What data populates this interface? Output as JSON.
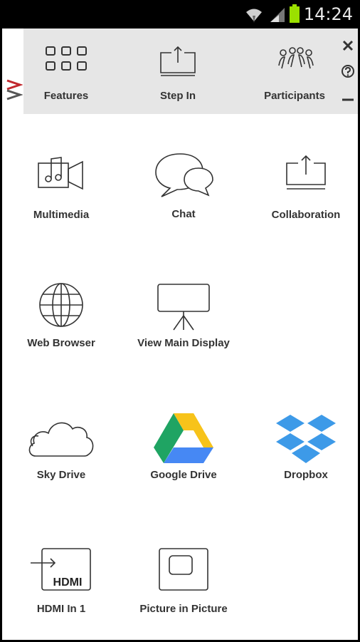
{
  "status_bar": {
    "time": "14:24",
    "icons": [
      "wifi-icon",
      "cell-signal-icon",
      "battery-icon"
    ]
  },
  "topbar": {
    "items": [
      {
        "label": "Features",
        "icon": "features-grid-icon"
      },
      {
        "label": "Step In",
        "icon": "step-in-icon"
      },
      {
        "label": "Participants",
        "icon": "participants-icon"
      }
    ],
    "controls": [
      "close-icon",
      "help-icon",
      "minimize-icon"
    ]
  },
  "grid": {
    "items": [
      {
        "label": "Multimedia",
        "icon": "multimedia-icon"
      },
      {
        "label": "Chat",
        "icon": "chat-icon"
      },
      {
        "label": "Collaboration",
        "icon": "collaboration-icon"
      },
      {
        "label": "Web Browser",
        "icon": "globe-icon"
      },
      {
        "label": "View Main Display",
        "icon": "projector-screen-icon"
      },
      {
        "label": "Sky Drive",
        "icon": "cloud-icon"
      },
      {
        "label": "Google Drive",
        "icon": "google-drive-icon"
      },
      {
        "label": "Dropbox",
        "icon": "dropbox-icon"
      },
      {
        "label": "HDMI In 1",
        "icon": "hdmi-input-icon"
      },
      {
        "label": "Picture in Picture",
        "icon": "picture-in-picture-icon"
      }
    ]
  },
  "colors": {
    "topbar_bg": "#e6e6e6",
    "status_bg": "#000000",
    "logo_red": "#c1272d",
    "battery_green": "#9be000",
    "dropbox_blue": "#3d9ae8"
  },
  "hdmi_icon_text": "HDMI"
}
